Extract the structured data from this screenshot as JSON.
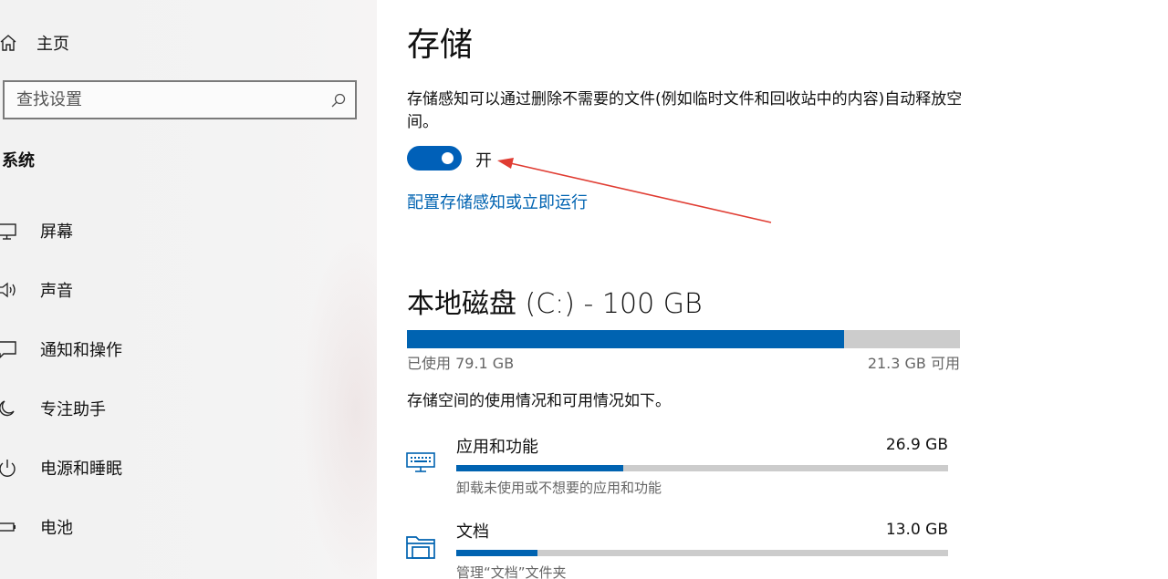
{
  "sidebar": {
    "home_label": "主页",
    "search_placeholder": "查找设置",
    "section_title": "系统",
    "items": [
      {
        "label": "屏幕",
        "icon": "monitor-icon"
      },
      {
        "label": "声音",
        "icon": "speaker-icon"
      },
      {
        "label": "通知和操作",
        "icon": "notification-icon"
      },
      {
        "label": "专注助手",
        "icon": "moon-icon"
      },
      {
        "label": "电源和睡眠",
        "icon": "power-icon"
      },
      {
        "label": "电池",
        "icon": "battery-icon"
      }
    ]
  },
  "main": {
    "title": "存储",
    "description": "存储感知可以通过删除不需要的文件(例如临时文件和回收站中的内容)自动释放空间。",
    "toggle_state": "开",
    "configure_link": "配置存储感知或立即运行",
    "disk": {
      "title": "本地磁盘 (C:) - 100 GB",
      "used_label": "已使用 79.1 GB",
      "free_label": "21.3 GB 可用",
      "used_fraction": 0.791
    },
    "usage_description": "存储空间的使用情况和可用情况如下。",
    "categories": [
      {
        "name": "应用和功能",
        "size": "26.9 GB",
        "desc": "卸载未使用或不想要的应用和功能",
        "icon": "keyboard-icon",
        "fraction": 0.34
      },
      {
        "name": "文档",
        "size": "13.0 GB",
        "desc": "管理“文档”文件夹",
        "icon": "folder-icon",
        "fraction": 0.165
      }
    ]
  },
  "colors": {
    "accent": "#0063b1",
    "annotation_arrow": "#e03c32"
  }
}
